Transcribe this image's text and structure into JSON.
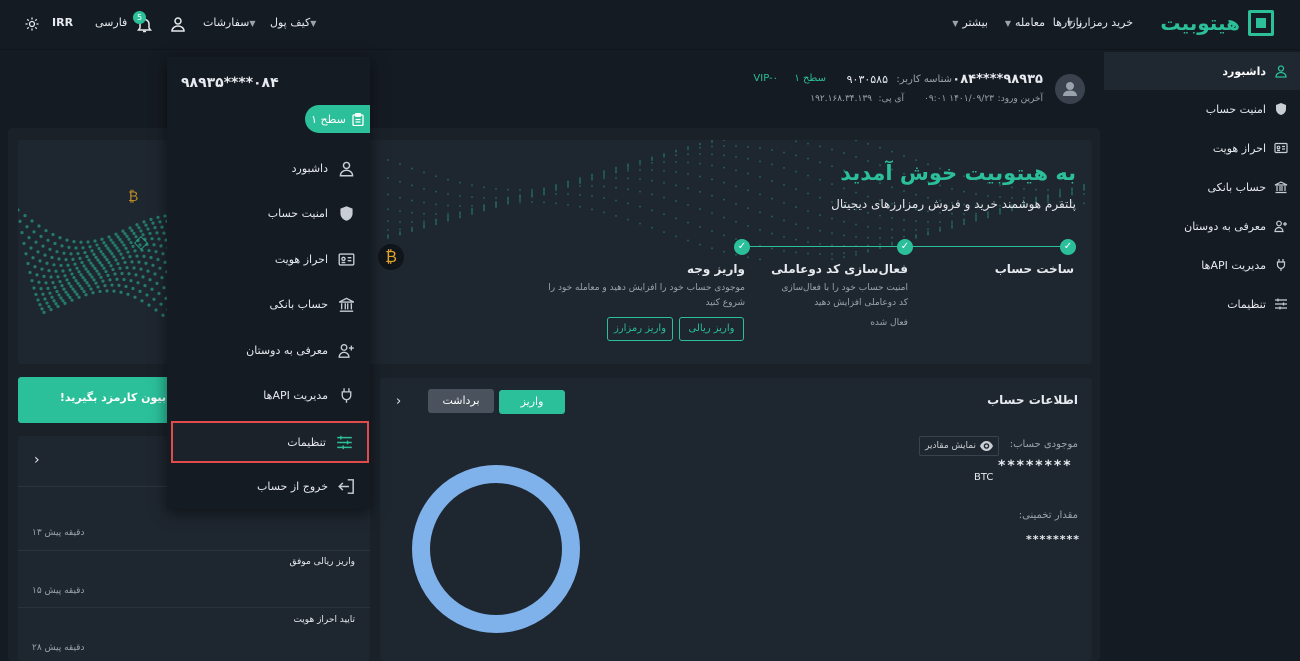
{
  "nav": {
    "logo_text": "هیتوبیت",
    "buy_crypto": "خرید رمزارز",
    "markets": "بازارها",
    "trade": "معامله",
    "more": "بیشتر",
    "wallet": "کیف پول",
    "orders": "سفارشات",
    "notif_count": "5",
    "language": "فارسی",
    "currency": "IRR"
  },
  "user": {
    "phone": "۹۸۹۳۵****۰۸۴",
    "user_id_label": "شناسه کاربر:",
    "user_id": "۹۰۳۰۵۸۵",
    "level": "سطح ۱",
    "vip": "VIP-۰",
    "last_login_label": "آخرین ورود:",
    "last_login": "۱۴۰۱/۰۹/۲۳ ۰۹:۰۱",
    "ip_label": "آی پی:",
    "ip": "۱۹۲.۱۶۸.۳۴.۱۳۹"
  },
  "sidebar": {
    "items": [
      {
        "label": "داشبورد"
      },
      {
        "label": "امنیت حساب"
      },
      {
        "label": "احراز هویت"
      },
      {
        "label": "حساب بانکی"
      },
      {
        "label": "معرفی به دوستان"
      },
      {
        "label": "مدیریت APIها"
      },
      {
        "label": "تنظیمات"
      }
    ]
  },
  "dropdown": {
    "phone": "۹۸۹۳۵****۰۸۴",
    "level": "سطح ۱",
    "items": [
      {
        "label": "داشبورد"
      },
      {
        "label": "امنیت حساب"
      },
      {
        "label": "احراز هویت"
      },
      {
        "label": "حساب بانکی"
      },
      {
        "label": "معرفی به دوستان"
      },
      {
        "label": "مدیریت APIها"
      },
      {
        "label": "تنظیمات"
      },
      {
        "label": "خروج از حساب"
      }
    ]
  },
  "welcome": {
    "title": "به هیتوبیت خوش آمدید",
    "subtitle": "پلتفرم هوشمند خرید و فروش رمزارزهای دیجیتال",
    "steps": [
      {
        "title": "ساخت حساب",
        "desc": "",
        "status": ""
      },
      {
        "title": "فعال‌سازی کد دوعاملی",
        "desc": "امنیت حساب خود را با فعال‌سازی کد دوعاملی افزایش دهید",
        "status": "فعال شده"
      },
      {
        "title": "واریز وجه",
        "desc": "موجودی حساب خود را افزایش دهید و معامله خود را شروع کنید",
        "status": ""
      }
    ],
    "btn_rial": "واریز ریالی",
    "btn_crypto": "واریز رمزارز"
  },
  "promo": {
    "text": "بیون کارمزد بگیرید!"
  },
  "account": {
    "title": "اطلاعات حساب",
    "deposit": "واریز",
    "withdraw": "برداشت",
    "balance_label": "موجودی حساب:",
    "show_values": "نمایش مقادیر",
    "balance_masked": "********",
    "balance_unit": "BTC",
    "estimate_label": "مقدار تخمینی:",
    "estimate_masked": "********"
  },
  "activity": {
    "items": [
      {
        "title": "",
        "time": "۱۳ دقیقه پیش"
      },
      {
        "title": "واریز ریالی موفق",
        "time": "۱۵ دقیقه پیش"
      },
      {
        "title": "تایید احراز هویت",
        "time": "۲۸ دقیقه پیش"
      }
    ]
  },
  "colors": {
    "accent": "#2bbf9a",
    "donut": "#7fb1ea",
    "highlight": "#e24b4b"
  }
}
